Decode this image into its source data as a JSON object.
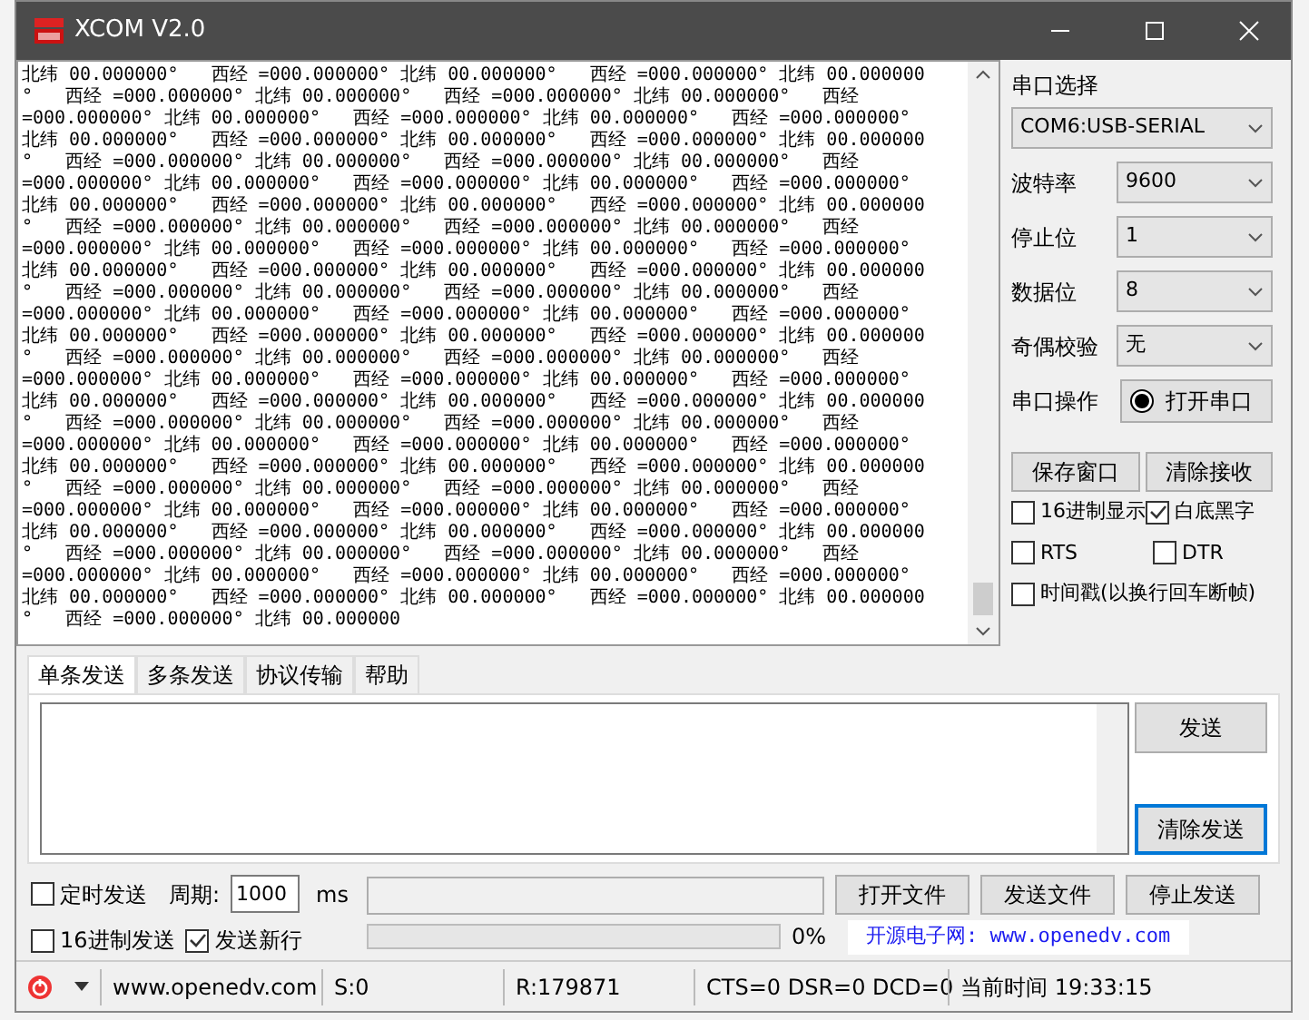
{
  "window": {
    "title": "XCOM V2.0"
  },
  "receive": {
    "lines": [
      "北纬 00.000000°   西经 =000.000000° 北纬 00.000000°   西经 =000.000000° 北纬 00.000000",
      "°   西经 =000.000000° 北纬 00.000000°   西经 =000.000000° 北纬 00.000000°   西经",
      "=000.000000° 北纬 00.000000°   西经 =000.000000° 北纬 00.000000°   西经 =000.000000°",
      "北纬 00.000000°   西经 =000.000000° 北纬 00.000000°   西经 =000.000000° 北纬 00.000000",
      "°   西经 =000.000000° 北纬 00.000000°   西经 =000.000000° 北纬 00.000000°   西经",
      "=000.000000° 北纬 00.000000°   西经 =000.000000° 北纬 00.000000°   西经 =000.000000°",
      "北纬 00.000000°   西经 =000.000000° 北纬 00.000000°   西经 =000.000000° 北纬 00.000000",
      "°   西经 =000.000000° 北纬 00.000000°   西经 =000.000000° 北纬 00.000000°   西经",
      "=000.000000° 北纬 00.000000°   西经 =000.000000° 北纬 00.000000°   西经 =000.000000°",
      "北纬 00.000000°   西经 =000.000000° 北纬 00.000000°   西经 =000.000000° 北纬 00.000000",
      "°   西经 =000.000000° 北纬 00.000000°   西经 =000.000000° 北纬 00.000000°   西经",
      "=000.000000° 北纬 00.000000°   西经 =000.000000° 北纬 00.000000°   西经 =000.000000°",
      "北纬 00.000000°   西经 =000.000000° 北纬 00.000000°   西经 =000.000000° 北纬 00.000000",
      "°   西经 =000.000000° 北纬 00.000000°   西经 =000.000000° 北纬 00.000000°   西经",
      "=000.000000° 北纬 00.000000°   西经 =000.000000° 北纬 00.000000°   西经 =000.000000°",
      "北纬 00.000000°   西经 =000.000000° 北纬 00.000000°   西经 =000.000000° 北纬 00.000000",
      "°   西经 =000.000000° 北纬 00.000000°   西经 =000.000000° 北纬 00.000000°   西经",
      "=000.000000° 北纬 00.000000°   西经 =000.000000° 北纬 00.000000°   西经 =000.000000°",
      "北纬 00.000000°   西经 =000.000000° 北纬 00.000000°   西经 =000.000000° 北纬 00.000000",
      "°   西经 =000.000000° 北纬 00.000000°   西经 =000.000000° 北纬 00.000000°   西经",
      "=000.000000° 北纬 00.000000°   西经 =000.000000° 北纬 00.000000°   西经 =000.000000°",
      "北纬 00.000000°   西经 =000.000000° 北纬 00.000000°   西经 =000.000000° 北纬 00.000000",
      "°   西经 =000.000000° 北纬 00.000000°   西经 =000.000000° 北纬 00.000000°   西经",
      "=000.000000° 北纬 00.000000°   西经 =000.000000° 北纬 00.000000°   西经 =000.000000°",
      "北纬 00.000000°   西经 =000.000000° 北纬 00.000000°   西经 =000.000000° 北纬 00.000000",
      "°   西经 =000.000000° 北纬 00.000000"
    ]
  },
  "serial": {
    "port_label": "串口选择",
    "port_value": "COM6:USB-SERIAL",
    "fields": [
      {
        "label": "波特率",
        "value": "9600"
      },
      {
        "label": "停止位",
        "value": "1"
      },
      {
        "label": "数据位",
        "value": "8"
      },
      {
        "label": "奇偶校验",
        "value": "无"
      }
    ],
    "operation": {
      "label": "串口操作",
      "button": "打开串口"
    },
    "buttons": [
      "保存窗口",
      "清除接收"
    ],
    "checkboxes": [
      {
        "label": "16进制显示",
        "checked": false
      },
      {
        "label": "白底黑字",
        "checked": true
      },
      {
        "label": "RTS",
        "checked": false
      },
      {
        "label": "DTR",
        "checked": false
      },
      {
        "label": "时间戳(以换行回车断帧)",
        "checked": false
      }
    ]
  },
  "tabs": [
    {
      "label": "单条发送",
      "selected": true
    },
    {
      "label": "多条发送",
      "selected": false
    },
    {
      "label": "协议传输",
      "selected": false
    },
    {
      "label": "帮助",
      "selected": false
    }
  ],
  "send": {
    "buttons": [
      {
        "label": "发送",
        "focused": false
      },
      {
        "label": "清除发送",
        "focused": true
      }
    ]
  },
  "options": {
    "timed_send": {
      "label": "定时发送",
      "checked": false
    },
    "period_label": "周期:",
    "period_value": "1000",
    "period_unit": "ms",
    "file_buttons": [
      "打开文件",
      "发送文件",
      "停止发送"
    ],
    "hex_send": {
      "label": "16进制发送",
      "checked": false
    },
    "newline": {
      "label": "发送新行",
      "checked": true
    },
    "progress": {
      "level": 0,
      "reading": "0%"
    },
    "site_label": "开源电子网: www.openedv.com"
  },
  "status_bar": {
    "url": "www.openedv.com",
    "sent": "S:0",
    "received": "R:179871",
    "lines": "CTS=0 DSR=0 DCD=0",
    "time": "当前时间 19:33:15"
  }
}
